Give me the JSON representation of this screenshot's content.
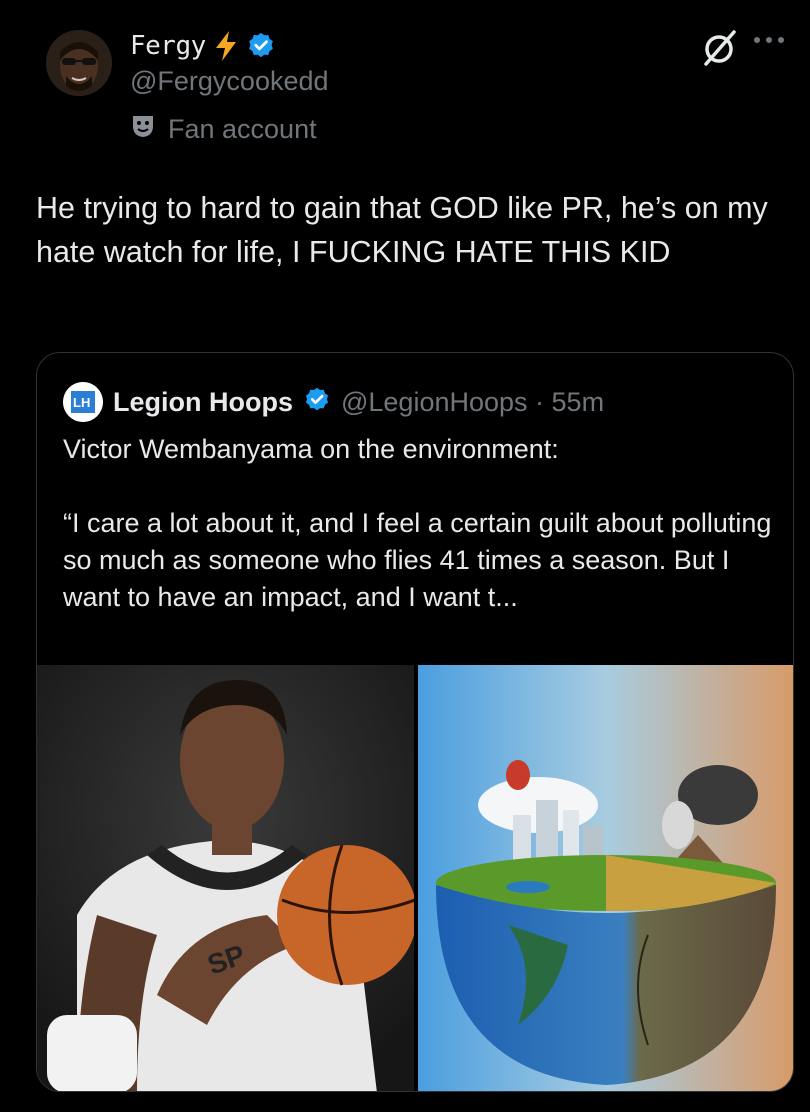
{
  "author": {
    "display_name": "Fergy",
    "handle": "@Fergycookedd",
    "label": "Fan account",
    "avatar_icon": "avatar-photo",
    "badges": [
      "lightning-emoji",
      "verified-badge"
    ]
  },
  "tweet": {
    "text": "He trying to hard to gain that GOD like PR, he’s on my hate watch for life, I FUCKING HATE THIS KID"
  },
  "quoted": {
    "display_name": "Legion Hoops",
    "handle": "@LegionHoops",
    "separator": " · ",
    "time": "55m",
    "line1": "Victor Wembanyama on the environment:",
    "line2": "“I care a lot about it, and I feel a certain guilt about polluting so much as someone who flies 41 times a season. But I want to have an impact, and I want t...",
    "images": [
      "player-photo",
      "earth-environment-illustration"
    ]
  },
  "colors": {
    "background": "#000000",
    "text": "#e7e9ea",
    "secondary": "#71767b",
    "verified": "#1d9bf0",
    "border": "#2f3336"
  }
}
